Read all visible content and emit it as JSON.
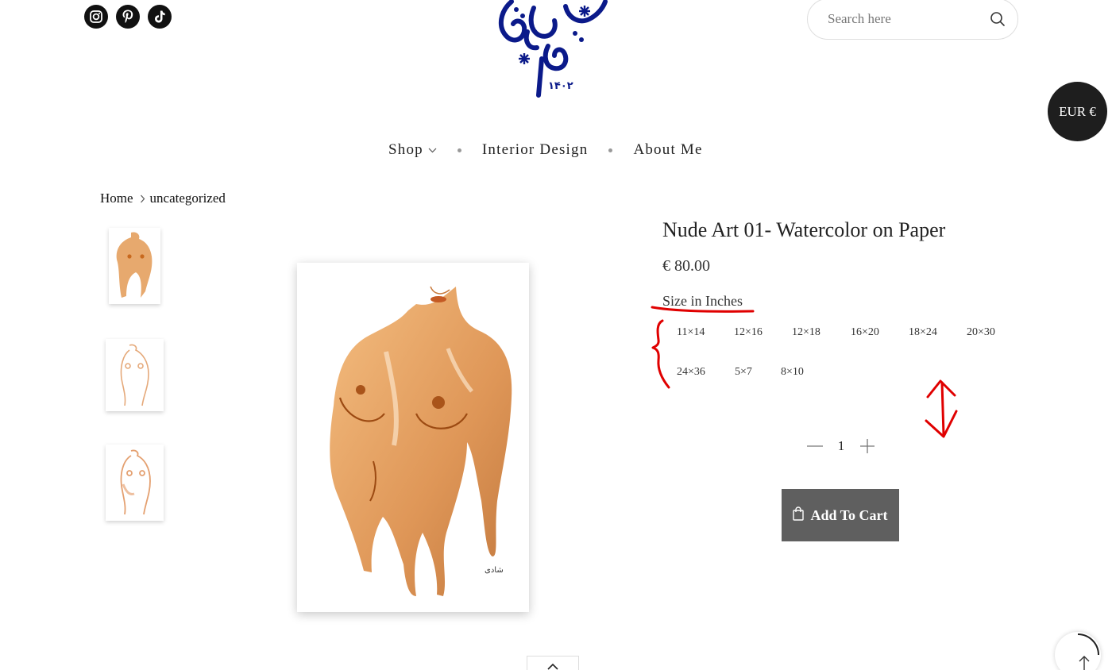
{
  "header": {
    "social_icons": [
      "instagram-icon",
      "pinterest-icon",
      "tiktok-icon"
    ],
    "logo_year": "۱۴۰۲",
    "search": {
      "placeholder": "Search here"
    },
    "currency": "EUR €"
  },
  "nav": {
    "items": [
      "Shop",
      "Interior Design",
      "About Me"
    ]
  },
  "breadcrumb": {
    "home": "Home",
    "category": "uncategorized"
  },
  "product": {
    "title": "Nude Art 01- Watercolor on Paper",
    "price": "€ 80.00",
    "size_label": "Size in Inches",
    "sizes": [
      "11×14",
      "12×16",
      "12×18",
      "16×20",
      "18×24",
      "20×30",
      "24×36",
      "5×7",
      "8×10"
    ],
    "quantity": "1",
    "add_to_cart_label": "Add To Cart",
    "artwork_signature": "ﺷﺎﺩی"
  },
  "colors": {
    "logo_blue": "#0b1a8a",
    "annotation_red": "#e00000",
    "button_gray": "#5f5f5f",
    "currency_bg": "#1e1e1e",
    "skin_tone": "#d9843a"
  }
}
